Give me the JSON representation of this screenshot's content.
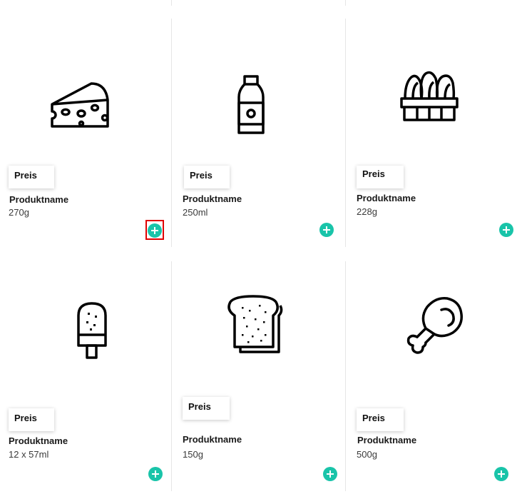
{
  "accent_color": "#19c4a9",
  "highlight_color": "#e00000",
  "products": [
    {
      "icon": "cheese-icon",
      "price_label": "Preis",
      "name": "Produktname",
      "size": "270g",
      "add_label": "+"
    },
    {
      "icon": "bottle-icon",
      "price_label": "Preis",
      "name": "Produktname",
      "size": "250ml",
      "add_label": "+"
    },
    {
      "icon": "eggs-carton-icon",
      "price_label": "Preis",
      "name": "Produktname",
      "size": "228g",
      "add_label": "+"
    },
    {
      "icon": "popsicle-icon",
      "price_label": "Preis",
      "name": "Produktname",
      "size": "12 x 57ml",
      "add_label": "+"
    },
    {
      "icon": "bread-toast-icon",
      "price_label": "Preis",
      "name": "Produktname",
      "size": "150g",
      "add_label": "+"
    },
    {
      "icon": "meat-drumstick-icon",
      "price_label": "Preis",
      "name": "Produktname",
      "size": "500g",
      "add_label": "+"
    }
  ]
}
